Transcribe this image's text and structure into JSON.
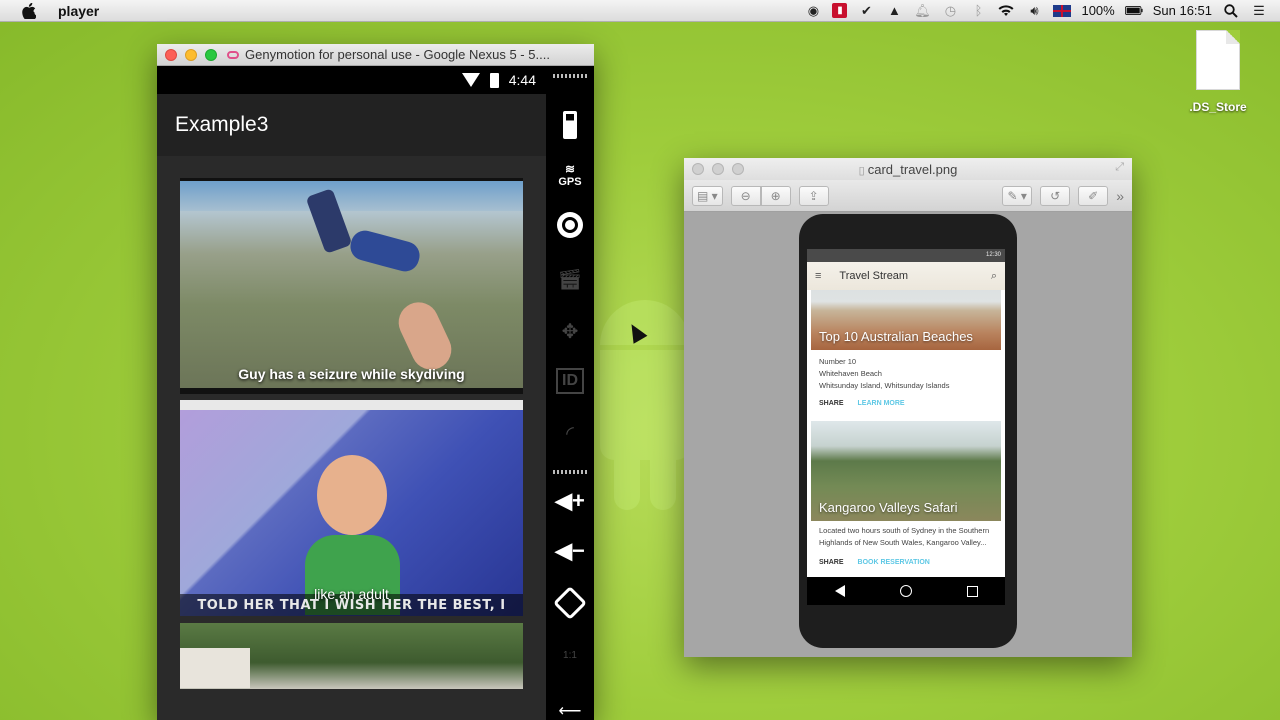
{
  "menubar": {
    "app_name": "player",
    "battery": "100%",
    "clock": "Sun 16:51"
  },
  "desktop": {
    "file_name": ".DS_Store"
  },
  "genymotion": {
    "window_title": "Genymotion for personal use - Google Nexus 5 - 5....",
    "status_time": "4:44",
    "app_title": "Example3",
    "cards": [
      {
        "caption": "Guy has a seizure while skydiving"
      },
      {
        "caption": "like an adult",
        "meme_text": "TOLD HER THAT I WISH HER THE BEST, I"
      },
      {
        "caption": ""
      }
    ],
    "sidebar": {
      "gps_label": "GPS",
      "id_label": "ID",
      "pixel_label": "1:1"
    }
  },
  "preview": {
    "window_title": "card_travel.png",
    "screen": {
      "status_time": "12:30",
      "app_title": "Travel Stream",
      "card1": {
        "title": "Top 10 Australian Beaches",
        "line1": "Number 10",
        "line2": "Whitehaven Beach",
        "line3": "Whitsunday Island, Whitsunday Islands",
        "action1": "SHARE",
        "action2": "LEARN MORE"
      },
      "card2": {
        "title": "Kangaroo Valleys Safari",
        "line1": "Located two hours south of Sydney in the Southern",
        "line2": "Highlands of New South Wales, Kangaroo Valley...",
        "action1": "SHARE",
        "action2": "BOOK RESERVATION"
      }
    }
  },
  "colors": {
    "desktop_green": "#9fcd3c",
    "accent_cyan": "#5ec8e5",
    "close_red": "#fc5f57"
  }
}
